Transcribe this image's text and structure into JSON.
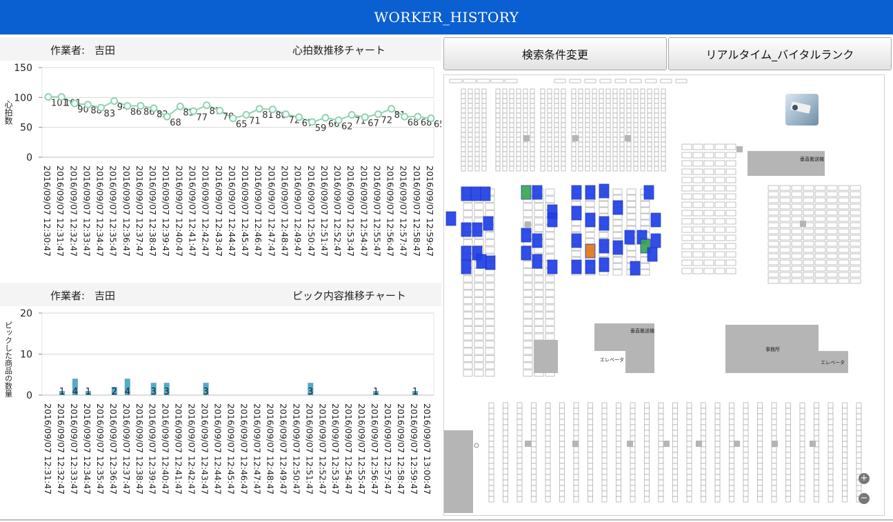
{
  "header": {
    "title": "WORKER_HISTORY"
  },
  "heart_panel": {
    "worker_label": "作業者:",
    "worker_name": "吉田",
    "title": "心拍数推移チャート"
  },
  "pick_panel": {
    "worker_label": "作業者:",
    "worker_name": "吉田",
    "title": "ピック内容推移チャート"
  },
  "buttons": {
    "search_change": "検索条件変更",
    "realtime_vital_rank": "リアルタイム_バイタルランク"
  },
  "map": {
    "zoom_in": "+",
    "zoom_out": "−",
    "labels": [
      "エレベータ",
      "エレベータ",
      "事務所",
      "垂直搬送機",
      "垂直搬送機"
    ]
  },
  "colors": {
    "header": "#0a5fd1",
    "heart_line": "#8fd3b2",
    "pick_bar": "#56a9c7",
    "rack_marker": "#2040e8",
    "rack_marker_hot": "#e0781c",
    "rack_marker_warm": "#39a852"
  },
  "chart_data": [
    {
      "type": "line",
      "ylabel": "心拍数",
      "ylim": [
        0,
        150
      ],
      "yticks": [
        0,
        50,
        100,
        150
      ],
      "grid": true,
      "x": [
        "2016/09/07 12:30:47",
        "2016/09/07 12:31:47",
        "2016/09/07 12:32:47",
        "2016/09/07 12:33:47",
        "2016/09/07 12:34:47",
        "2016/09/07 12:35:47",
        "2016/09/07 12:36:47",
        "2016/09/07 12:37:47",
        "2016/09/07 12:38:47",
        "2016/09/07 12:39:47",
        "2016/09/07 12:40:47",
        "2016/09/07 12:41:47",
        "2016/09/07 12:42:47",
        "2016/09/07 12:43:47",
        "2016/09/07 12:44:47",
        "2016/09/07 12:45:47",
        "2016/09/07 12:46:47",
        "2016/09/07 12:47:47",
        "2016/09/07 12:48:47",
        "2016/09/07 12:49:47",
        "2016/09/07 12:50:47",
        "2016/09/07 12:51:47",
        "2016/09/07 12:52:47",
        "2016/09/07 12:53:47",
        "2016/09/07 12:54:47",
        "2016/09/07 12:55:47",
        "2016/09/07 12:56:47",
        "2016/09/07 12:57:47",
        "2016/09/07 12:58:47",
        "2016/09/07 12:59:47"
      ],
      "values": [
        101,
        101,
        90,
        88,
        83,
        94,
        86,
        86,
        82,
        68,
        85,
        77,
        87,
        78,
        65,
        71,
        81,
        80,
        72,
        67,
        59,
        66,
        62,
        71,
        67,
        72,
        81,
        68,
        68,
        65
      ],
      "labels": [
        "101",
        "101",
        "90",
        "88",
        "83",
        "94",
        "86",
        "86",
        "82",
        "68",
        "85",
        "77",
        "87",
        "78",
        "65",
        "71",
        "81",
        "80",
        "72",
        "67",
        "59",
        "66",
        "62",
        "71",
        "67",
        "72",
        "81",
        "68",
        "68",
        "65"
      ]
    },
    {
      "type": "bar",
      "ylabel": "ピックした商品の数量",
      "ylim": [
        0,
        20
      ],
      "yticks": [
        0,
        10,
        20
      ],
      "grid": true,
      "categories": [
        "2016/09/07 12:31:47",
        "2016/09/07 12:32:47",
        "2016/09/07 12:33:47",
        "2016/09/07 12:34:47",
        "2016/09/07 12:35:47",
        "2016/09/07 12:36:47",
        "2016/09/07 12:37:47",
        "2016/09/07 12:38:47",
        "2016/09/07 12:39:47",
        "2016/09/07 12:40:47",
        "2016/09/07 12:41:47",
        "2016/09/07 12:42:47",
        "2016/09/07 12:43:47",
        "2016/09/07 12:44:47",
        "2016/09/07 12:45:47",
        "2016/09/07 12:46:47",
        "2016/09/07 12:47:47",
        "2016/09/07 12:48:47",
        "2016/09/07 12:49:47",
        "2016/09/07 12:50:47",
        "2016/09/07 12:51:47",
        "2016/09/07 12:52:47",
        "2016/09/07 12:53:47",
        "2016/09/07 12:54:47",
        "2016/09/07 12:55:47",
        "2016/09/07 12:56:47",
        "2016/09/07 12:57:47",
        "2016/09/07 12:58:47",
        "2016/09/07 12:59:47",
        "2016/09/07 13:00:47"
      ],
      "values": [
        0,
        1,
        4,
        1,
        0,
        2,
        4,
        0,
        3,
        3,
        0,
        0,
        3,
        0,
        0,
        0,
        0,
        0,
        0,
        0,
        3,
        0,
        0,
        0,
        0,
        1,
        0,
        0,
        1,
        0
      ]
    }
  ]
}
